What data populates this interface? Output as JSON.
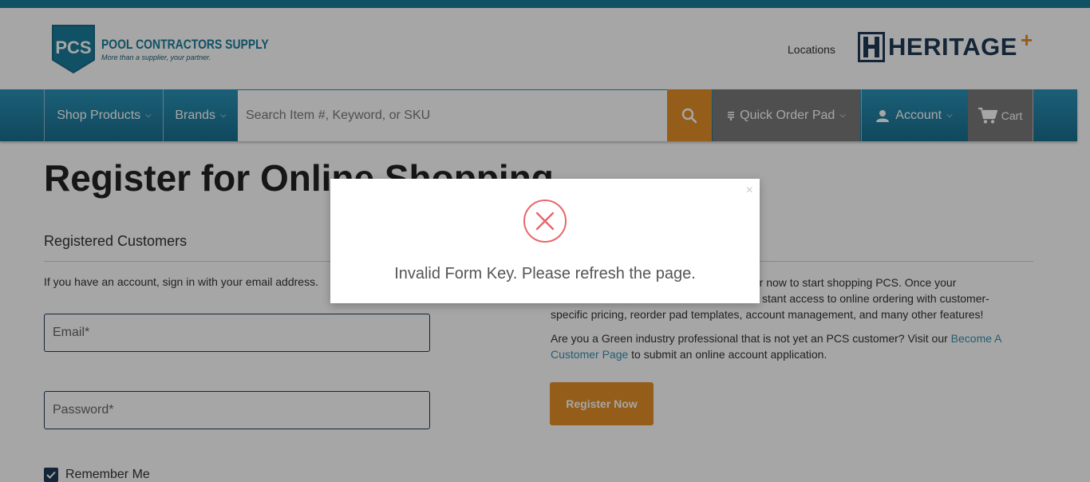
{
  "header": {
    "logo": {
      "badge_text": "PCS",
      "name": "POOL CONTRACTORS SUPPLY",
      "tagline": "More than a supplier, your partner."
    },
    "locations_label": "Locations",
    "partner_logo": {
      "word": "HERITAGE",
      "plus": "+"
    }
  },
  "nav": {
    "shop_products": "Shop Products",
    "brands": "Brands",
    "search_placeholder": "Search Item #, Keyword, or SKU",
    "quick_order_pad": "Quick Order Pad",
    "account": "Account",
    "cart": "Cart"
  },
  "page": {
    "title": "Register for Online Shopping",
    "registered": {
      "heading": "Registered Customers",
      "intro": "If you have an account, sign in with your email address.",
      "email_placeholder": "Email*",
      "password_placeholder": "Password*",
      "remember_me": "Remember Me"
    },
    "new_customers": {
      "line1": "ter now to start shopping PCS. Once your",
      "line2": "stant access to online ordering with customer-",
      "line3": "specific pricing, reorder pad templates, account management, and many other features!",
      "green_text_before": "Are you a Green industry professional that is not yet an PCS customer? Visit our",
      "green_link_1": "Become A",
      "green_link_2": "Customer Page",
      "green_text_after": " to submit an online account application.",
      "register_button": "Register Now"
    }
  },
  "modal": {
    "message": "Invalid Form Key. Please refresh the page.",
    "close_glyph": "×"
  },
  "colors": {
    "brand_blue": "#1b7d9c",
    "accent_orange": "#e39027",
    "navy": "#1e3a55",
    "error_red": "#e8676b"
  }
}
